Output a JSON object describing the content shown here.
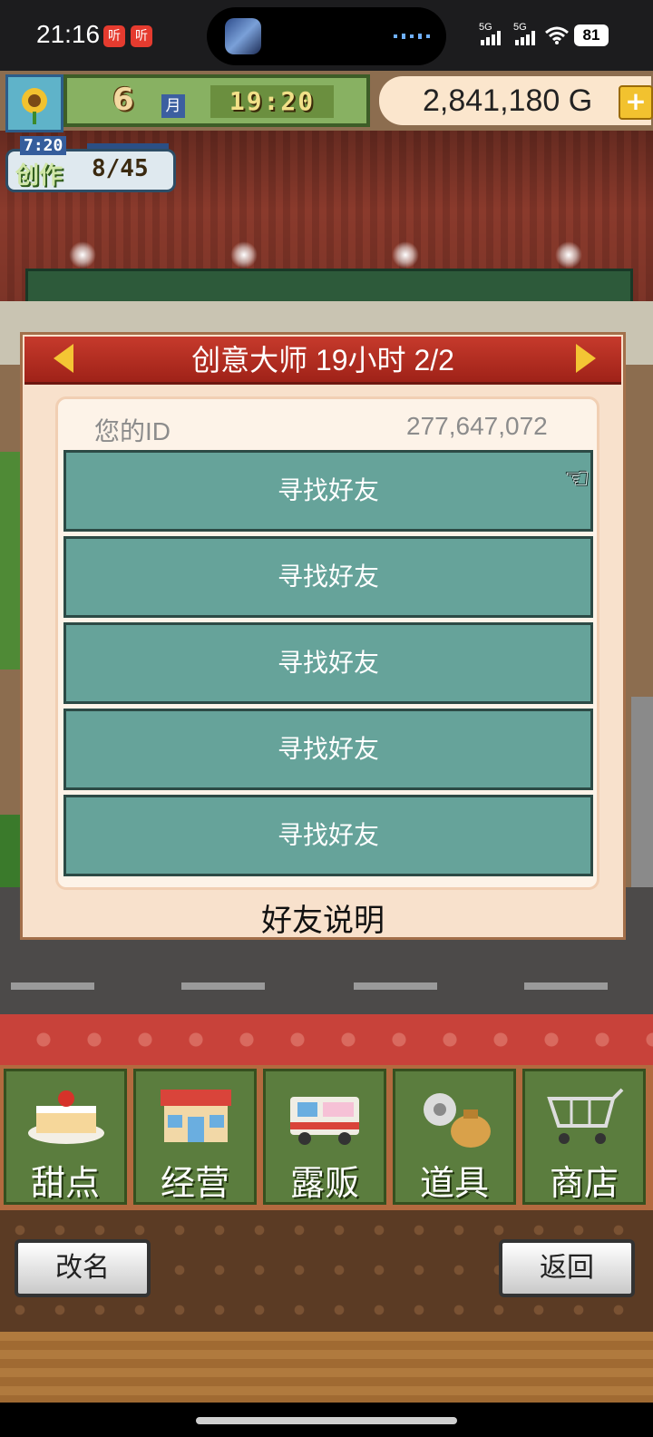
{
  "status_bar": {
    "time": "21:16",
    "badges": [
      "听",
      "听"
    ],
    "network_1": "5G",
    "network_2": "5G",
    "battery": "81"
  },
  "hud": {
    "month": "6",
    "month_unit": "月",
    "game_time": "19:20",
    "money": "2,841,180 G",
    "money_add_icon": "plus-icon",
    "creation_timer": "7:20",
    "creation_label": "创作",
    "creation_count": "8/45"
  },
  "dialog": {
    "title": "创意大师  19小时 2/2",
    "id_label": "您的ID",
    "id_value": "277,647,072",
    "friend_slots": [
      "寻找好友",
      "寻找好友",
      "寻找好友",
      "寻找好友",
      "寻找好友"
    ],
    "explain_label": "好友说明"
  },
  "menu": {
    "items": [
      {
        "label": "甜点",
        "icon": "cake-icon"
      },
      {
        "label": "经营",
        "icon": "shop-icon"
      },
      {
        "label": "露贩",
        "icon": "food-truck-icon"
      },
      {
        "label": "道具",
        "icon": "items-bag-icon"
      },
      {
        "label": "商店",
        "icon": "cart-icon"
      }
    ]
  },
  "buttons": {
    "rename": "改名",
    "back": "返回"
  },
  "colors": {
    "dialog_bg": "#f8e1cc",
    "title_red": "#c63a2c",
    "slot_teal": "#66a39a",
    "menu_green": "#5b7d3e"
  }
}
